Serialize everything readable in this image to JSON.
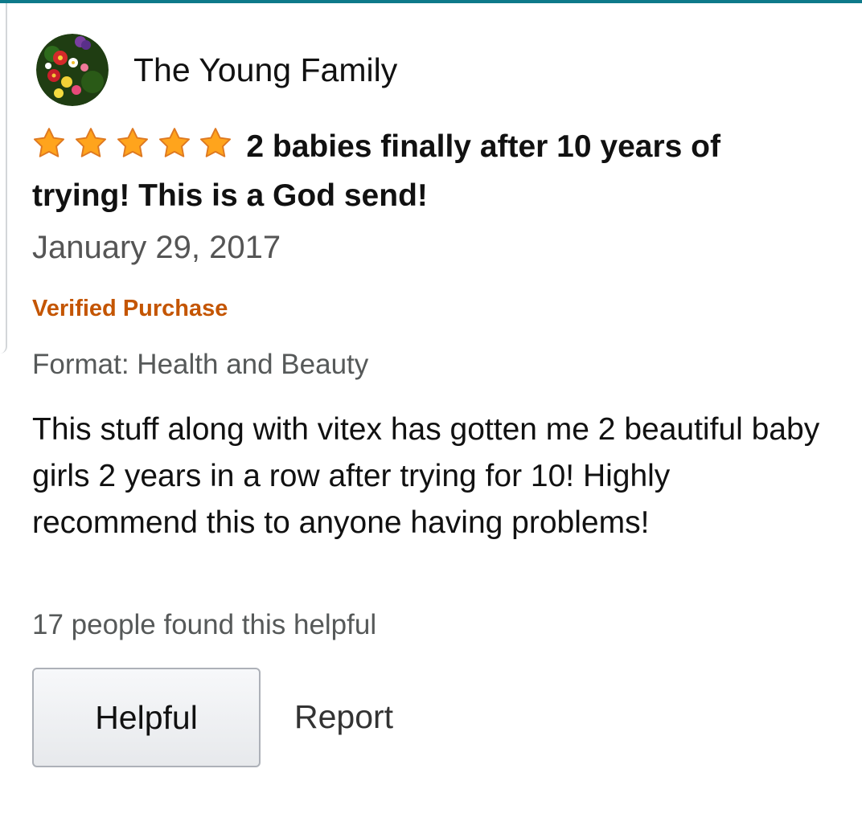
{
  "review": {
    "reviewer_name": "The Young Family",
    "rating": 5,
    "rating_max": 5,
    "title": "2 babies finally after 10 years of trying! This is a God send!",
    "date": "January 29, 2017",
    "verified_label": "Verified Purchase",
    "format": "Format: Health and Beauty",
    "body": "This stuff along with vitex has gotten me 2 beautiful baby girls 2 years in a row after trying for 10! Highly recommend this to anyone having problems!",
    "helpful_count_text": "17 people found this helpful"
  },
  "actions": {
    "helpful_label": "Helpful",
    "report_label": "Report"
  },
  "colors": {
    "accent_top_rule": "#0e7a8a",
    "star_fill": "#ffa41c",
    "star_stroke": "#de7921",
    "verified": "#c45500"
  },
  "icons": {
    "avatar": "flower-avatar",
    "star": "star-icon"
  }
}
